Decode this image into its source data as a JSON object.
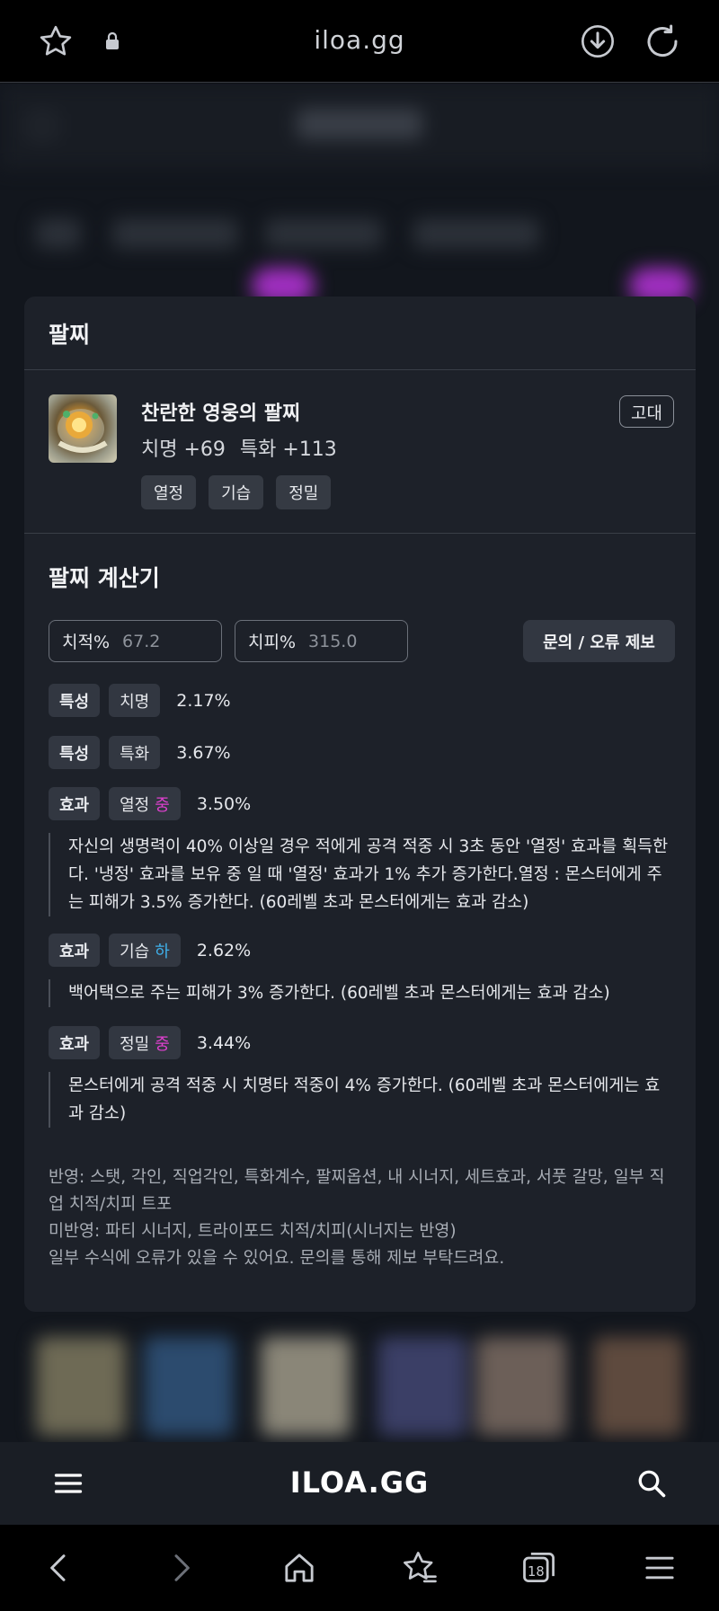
{
  "browser": {
    "url": "iloa.gg",
    "tab_count": "18"
  },
  "site": {
    "logo": "ILOA.GG"
  },
  "card": {
    "title": "팔찌",
    "item": {
      "name": "찬란한 영웅의 팔찌",
      "stat1": "치명 +69",
      "stat2": "특화 +113",
      "grade": "고대",
      "tags": [
        "열정",
        "기습",
        "정밀"
      ]
    },
    "calculator": {
      "title": "팔찌 계산기",
      "crit_rate_label": "치적%",
      "crit_rate_value": "67.2",
      "crit_dmg_label": "치피%",
      "crit_dmg_value": "315.0",
      "report_button": "문의 / 오류 제보",
      "rows": [
        {
          "type": "특성",
          "name": "치명",
          "level": "",
          "pct": "2.17%"
        },
        {
          "type": "특성",
          "name": "특화",
          "level": "",
          "pct": "3.67%"
        },
        {
          "type": "효과",
          "name": "열정",
          "level": "중",
          "pct": "3.50%",
          "desc": "자신의 생명력이 40% 이상일 경우 적에게 공격 적중 시 3초 동안 '열정' 효과를 획득한다. '냉정' 효과를 보유 중 일 때 '열정' 효과가 1% 추가 증가한다.열정 : 몬스터에게 주는 피해가 3.5% 증가한다. (60레벨 초과 몬스터에게는 효과 감소)"
        },
        {
          "type": "효과",
          "name": "기습",
          "level": "하",
          "pct": "2.62%",
          "desc": "백어택으로 주는 피해가 3% 증가한다. (60레벨 초과 몬스터에게는 효과 감소)"
        },
        {
          "type": "효과",
          "name": "정밀",
          "level": "중",
          "pct": "3.44%",
          "desc": "몬스터에게 공격 적중 시 치명타 적중이 4% 증가한다. (60레벨 초과 몬스터에게는 효과 감소)"
        }
      ],
      "notes": {
        "reflected": "반영: 스탯, 각인, 직업각인, 특화계수, 팔찌옵션, 내 시너지, 세트효과, 서풋 갈망, 일부 직업 치적/치피 트포",
        "not_reflected": "미반영: 파티 시너지, 트라이포드 치적/치피(시너지는 반영)",
        "disclaimer": "일부 수식에 오류가 있을 수 있어요. 문의를 통해 제보 부탁드려요."
      }
    }
  },
  "colors": {
    "level_mid": "#e040d0",
    "level_low": "#3fb0ea",
    "card_bg": "#1d2129"
  }
}
